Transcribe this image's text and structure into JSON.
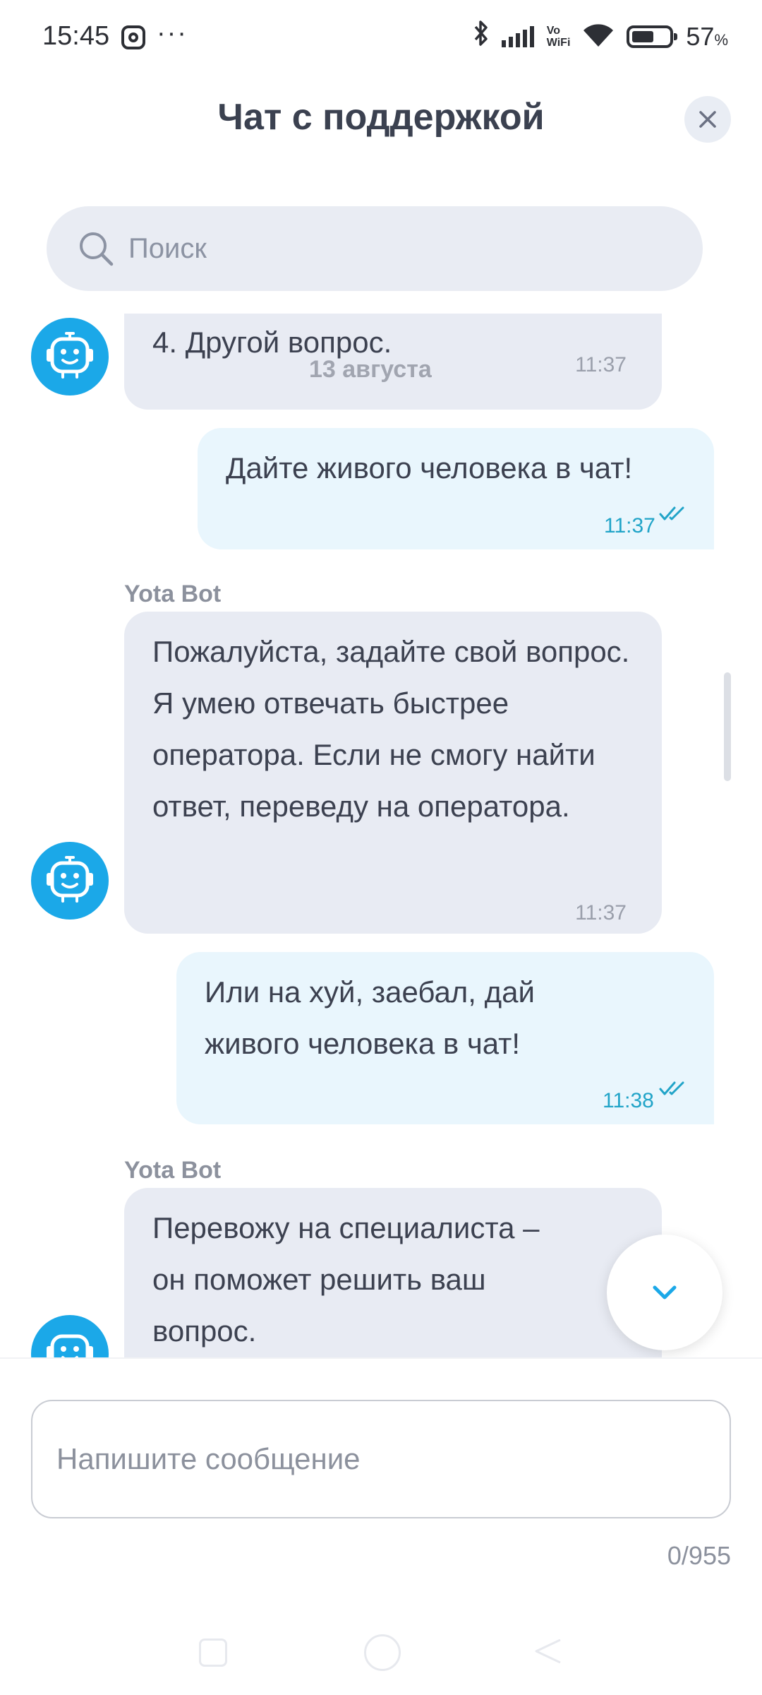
{
  "status_bar": {
    "time": "15:45",
    "more": "···",
    "network_label_top": "Vo",
    "network_label_bottom": "WiFi",
    "battery_percent": "57",
    "battery_unit": "%",
    "battery_level": 0.57,
    "icons": [
      "instagram-icon",
      "bluetooth-icon",
      "signal-icon",
      "vowifi-icon",
      "wifi-icon",
      "battery-icon"
    ]
  },
  "header": {
    "title": "Чат с поддержкой",
    "close_icon": "close-icon"
  },
  "search": {
    "placeholder": "Поиск",
    "icon": "search-icon"
  },
  "chat": {
    "messages": [
      {
        "direction": "in",
        "text": "4. Другой вопрос.",
        "time": "11:37"
      },
      {
        "direction": "date",
        "text": "13 августа"
      },
      {
        "direction": "out",
        "text": "Дайте живого человека в чат!",
        "time": "11:37",
        "status": "read"
      },
      {
        "direction": "in",
        "sender": "Yota Bot",
        "text": "Пожалуйста, задайте свой вопрос. Я умею отвечать быстрее оператора. Если не смогу найти ответ, переведу на оператора.",
        "time": "11:37"
      },
      {
        "direction": "out",
        "text": "Или на хуй, заебал, дай живого человека в чат!",
        "time": "11:38",
        "status": "read"
      },
      {
        "direction": "in",
        "sender": "Yota Bot",
        "text": "Перевожу на специалиста – он поможет решить ваш вопрос."
      }
    ],
    "bot_avatar_icon": "robot-icon",
    "scroll_down_icon": "chevron-down-icon"
  },
  "composer": {
    "placeholder": "Напишите сообщение",
    "counter": "0/955"
  },
  "colors": {
    "accent": "#1ba8e8",
    "incoming_bubble": "#e8ebf3",
    "outgoing_bubble": "#e9f6fd",
    "outgoing_time": "#21a4c8",
    "title": "#3b4150"
  }
}
